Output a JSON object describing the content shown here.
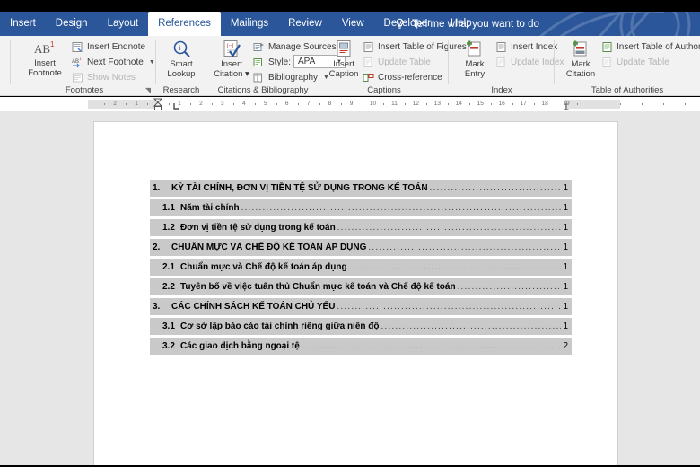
{
  "window": {
    "accent_color": "#2b579a",
    "ribbon_bg": "#f2f2f2",
    "canvas_bg": "#e6e6e6",
    "field_shading": "#c9c9c9"
  },
  "tabs": [
    {
      "label": "Insert",
      "active": false
    },
    {
      "label": "Design",
      "active": false
    },
    {
      "label": "Layout",
      "active": false
    },
    {
      "label": "References",
      "active": true
    },
    {
      "label": "Mailings",
      "active": false
    },
    {
      "label": "Review",
      "active": false
    },
    {
      "label": "View",
      "active": false
    },
    {
      "label": "Developer",
      "active": false
    },
    {
      "label": "Help",
      "active": false
    }
  ],
  "tell_me": {
    "icon": "lightbulb-icon",
    "label": "Tell me what you want to do"
  },
  "ribbon": {
    "groups": [
      {
        "name": "Footnotes",
        "dialog_launcher": true,
        "big_buttons": [
          {
            "icon": "insert-footnote-icon",
            "label_line1": "Insert",
            "label_line2": "Footnote"
          }
        ],
        "small_items": [
          {
            "icon": "insert-endnote-icon",
            "label": "Insert Endnote",
            "disabled": false,
            "caret": false
          },
          {
            "icon": "next-footnote-icon",
            "label": "Next Footnote",
            "disabled": false,
            "caret": true
          },
          {
            "icon": "show-notes-icon",
            "label": "Show Notes",
            "disabled": true,
            "caret": false
          }
        ]
      },
      {
        "name": "Research",
        "dialog_launcher": false,
        "big_buttons": [
          {
            "icon": "smart-lookup-icon",
            "label_line1": "Smart",
            "label_line2": "Lookup"
          }
        ],
        "small_items": []
      },
      {
        "name": "Citations & Bibliography",
        "dialog_launcher": false,
        "big_buttons": [
          {
            "icon": "insert-citation-icon",
            "label_line1": "Insert",
            "label_line2": "Citation ▾"
          }
        ],
        "small_items": [
          {
            "icon": "manage-sources-icon",
            "label": "Manage Sources",
            "disabled": false,
            "caret": false
          },
          {
            "icon": "style-icon",
            "label": "Style:",
            "disabled": false,
            "caret": false
          },
          {
            "icon": "bibliography-icon",
            "label": "Bibliography",
            "disabled": false,
            "caret": true
          }
        ],
        "style_dropdown": {
          "value": "APA"
        }
      },
      {
        "name": "Captions",
        "dialog_launcher": false,
        "big_buttons": [
          {
            "icon": "insert-caption-icon",
            "label_line1": "Insert",
            "label_line2": "Caption"
          }
        ],
        "small_items": [
          {
            "icon": "insert-table-of-figures-icon",
            "label": "Insert Table of Figures",
            "disabled": false,
            "caret": false
          },
          {
            "icon": "update-table-icon",
            "label": "Update Table",
            "disabled": true,
            "caret": false
          },
          {
            "icon": "cross-reference-icon",
            "label": "Cross-reference",
            "disabled": false,
            "caret": false
          }
        ]
      },
      {
        "name": "Index",
        "dialog_launcher": false,
        "big_buttons": [
          {
            "icon": "mark-entry-icon",
            "label_line1": "Mark",
            "label_line2": "Entry"
          }
        ],
        "small_items": [
          {
            "icon": "insert-index-icon",
            "label": "Insert Index",
            "disabled": false,
            "caret": false
          },
          {
            "icon": "update-index-icon",
            "label": "Update Index",
            "disabled": true,
            "caret": false
          }
        ]
      },
      {
        "name": "Table of Authorities",
        "dialog_launcher": false,
        "big_buttons": [
          {
            "icon": "mark-citation-icon",
            "label_line1": "Mark",
            "label_line2": "Citation"
          }
        ],
        "small_items": [
          {
            "icon": "insert-table-of-authorities-icon",
            "label": "Insert Table of Authorities",
            "disabled": false,
            "caret": false
          },
          {
            "icon": "update-table-icon",
            "label": "Update Table",
            "disabled": true,
            "caret": false
          }
        ]
      }
    ]
  },
  "ruler": {
    "unit_labels_left": [
      "2",
      "1"
    ],
    "unit_labels_right": [
      "1",
      "2",
      "3",
      "4",
      "5",
      "6",
      "7",
      "8",
      "9",
      "10",
      "11",
      "12",
      "13",
      "14",
      "15",
      "16",
      "17",
      "18",
      "19"
    ],
    "left_indent_marker": "hourglass-indent-marker",
    "tab_stop_marker": "left-tab-stop"
  },
  "document": {
    "toc_entries": [
      {
        "level": 1,
        "number": "1.",
        "title": "KỲ TÀI CHÍNH, ĐƠN VỊ TIỀN TỆ SỬ DỤNG TRONG KẾ TOÁN",
        "page": "1"
      },
      {
        "level": 2,
        "number": "1.1",
        "title": "Năm tài chính",
        "page": "1"
      },
      {
        "level": 2,
        "number": "1.2",
        "title": "Đơn vị tiền tệ sử dụng trong kế toán",
        "page": "1"
      },
      {
        "level": 1,
        "number": "2.",
        "title": "CHUẨN MỰC VÀ CHẾ ĐỘ KẾ TOÁN ÁP DỤNG",
        "page": "1"
      },
      {
        "level": 2,
        "number": "2.1",
        "title": "Chuẩn mực và Chế độ kế toán áp dụng",
        "page": "1"
      },
      {
        "level": 2,
        "number": "2.2",
        "title": "Tuyên bố về việc tuân thủ Chuẩn mực kế toán và Chế độ kế toán",
        "page": "1"
      },
      {
        "level": 1,
        "number": "3.",
        "title": "CÁC CHÍNH SÁCH KẾ TOÁN CHỦ YẾU",
        "page": "1"
      },
      {
        "level": 2,
        "number": "3.1",
        "title": "Cơ sở lập báo cáo tài chính riêng giữa niên độ",
        "page": "1"
      },
      {
        "level": 2,
        "number": "3.2",
        "title": "Các giao dịch bằng ngoại tệ",
        "page": "2"
      }
    ]
  }
}
